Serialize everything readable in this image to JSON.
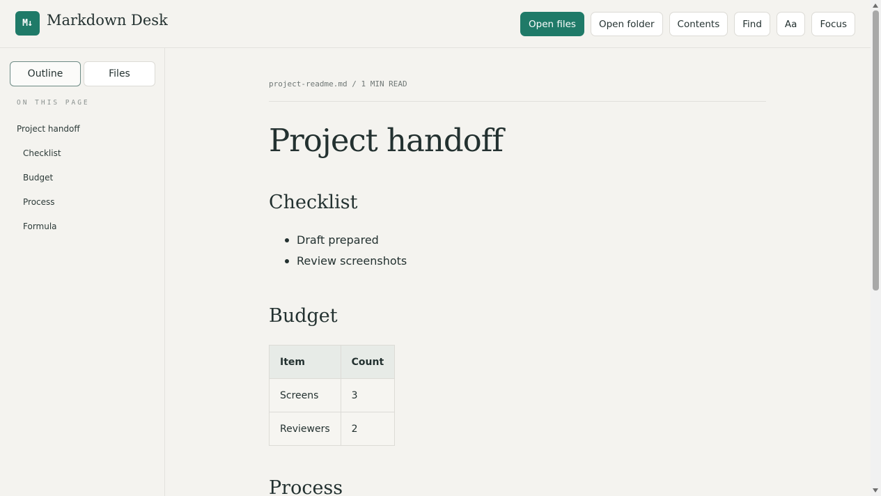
{
  "app": {
    "logo_text": "M↓",
    "title": "Markdown Desk",
    "accent_color": "#1f7a68"
  },
  "toolbar": {
    "open_files": "Open files",
    "open_folder": "Open folder",
    "contents": "Contents",
    "find": "Find",
    "font_toggle": "Aa",
    "focus": "Focus"
  },
  "sidebar": {
    "tabs": [
      {
        "label": "Outline",
        "active": true
      },
      {
        "label": "Files",
        "active": false
      }
    ],
    "section_label": "ON THIS PAGE",
    "toc": [
      {
        "label": "Project handoff",
        "level": 1
      },
      {
        "label": "Checklist",
        "level": 2
      },
      {
        "label": "Budget",
        "level": 2
      },
      {
        "label": "Process",
        "level": 2
      },
      {
        "label": "Formula",
        "level": 2
      }
    ]
  },
  "document": {
    "meta": "project-readme.md / 1 MIN READ",
    "title": "Project handoff",
    "checklist": {
      "heading": "Checklist",
      "items": [
        "Draft prepared",
        "Review screenshots"
      ]
    },
    "budget": {
      "heading": "Budget",
      "columns": [
        "Item",
        "Count"
      ],
      "rows": [
        [
          "Screens",
          "3"
        ],
        [
          "Reviewers",
          "2"
        ]
      ]
    },
    "process": {
      "heading": "Process"
    }
  }
}
